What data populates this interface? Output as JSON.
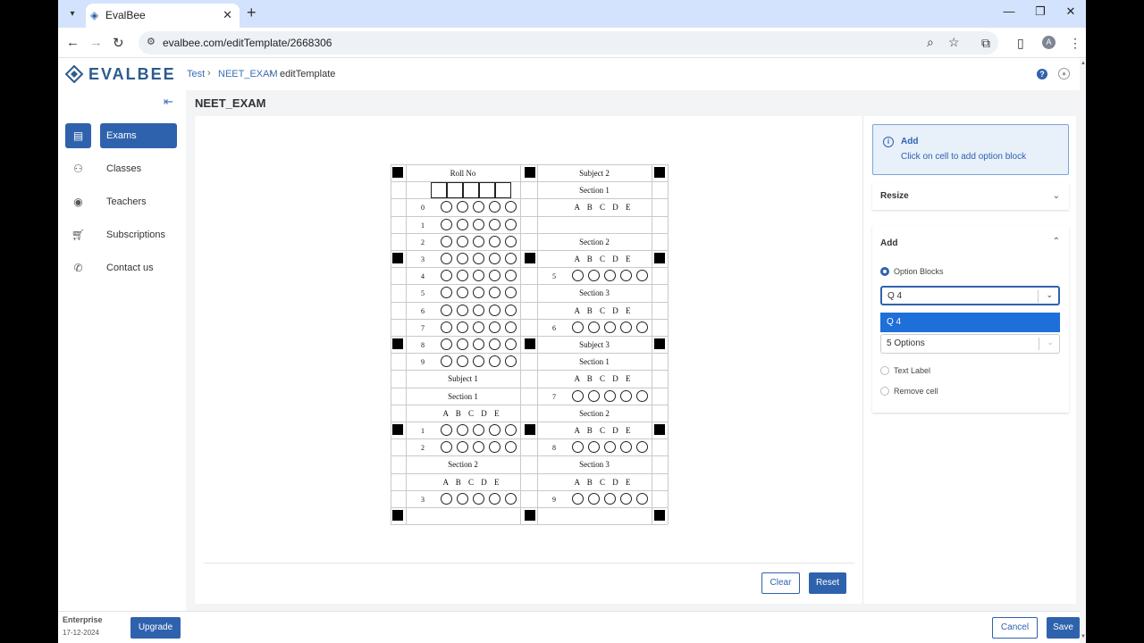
{
  "browser": {
    "tab_title": "EvalBee",
    "url": "evalbee.com/editTemplate/2668306",
    "profile_initial": "A"
  },
  "app": {
    "logo_text": "EVALBEE",
    "breadcrumb": [
      "Test",
      "NEET_EXAM",
      "editTemplate"
    ],
    "page_title": "NEET_EXAM"
  },
  "sidebar": {
    "items": [
      {
        "label": "Exams",
        "icon": "clipboard-icon",
        "active": true
      },
      {
        "label": "Classes",
        "icon": "users-icon",
        "active": false
      },
      {
        "label": "Teachers",
        "icon": "user-circle-icon",
        "active": false
      },
      {
        "label": "Subscriptions",
        "icon": "cart-icon",
        "active": false
      },
      {
        "label": "Contact us",
        "icon": "phone-icon",
        "active": false
      }
    ]
  },
  "sheet": {
    "left": {
      "header": "Roll No",
      "roll_digits": [
        "0",
        "1",
        "2",
        "3",
        "4",
        "5",
        "6",
        "7",
        "8",
        "9"
      ],
      "subject": "Subject 1",
      "section1": "Section 1",
      "section2": "Section 2",
      "options": "A  B  C  D  E",
      "q_numbers": [
        "1",
        "2",
        "3"
      ]
    },
    "right": {
      "header": "Subject 2",
      "rows": [
        "Section 1",
        "A  B  C  D  E",
        "",
        "Section 2",
        "A  B  C  D  E",
        "5",
        "Section 3",
        "A  B  C  D  E",
        "6",
        "Subject 3",
        "Section 1",
        "A  B  C  D  E",
        "7",
        "Section 2",
        "A  B  C  D  E",
        "8",
        "Section 3",
        "A  B  C  D  E",
        "9"
      ]
    }
  },
  "canvas_buttons": {
    "clear": "Clear",
    "reset": "Reset"
  },
  "panel": {
    "info_title": "Add",
    "info_text": "Click on cell to add option block",
    "resize_title": "Resize",
    "add_title": "Add",
    "option_blocks_label": "Option Blocks",
    "question_select_value": "Q 4",
    "dropdown_highlight": "Q 4",
    "options_select_value": "5 Options",
    "text_label": "Text Label",
    "remove_cell": "Remove cell"
  },
  "footer": {
    "plan": "Enterprise",
    "plan_date": "17-12-2024",
    "upgrade": "Upgrade",
    "cancel": "Cancel",
    "save": "Save"
  },
  "colors": {
    "brand": "#2f62ad",
    "dropdown_highlight": "#1e6fd9"
  }
}
